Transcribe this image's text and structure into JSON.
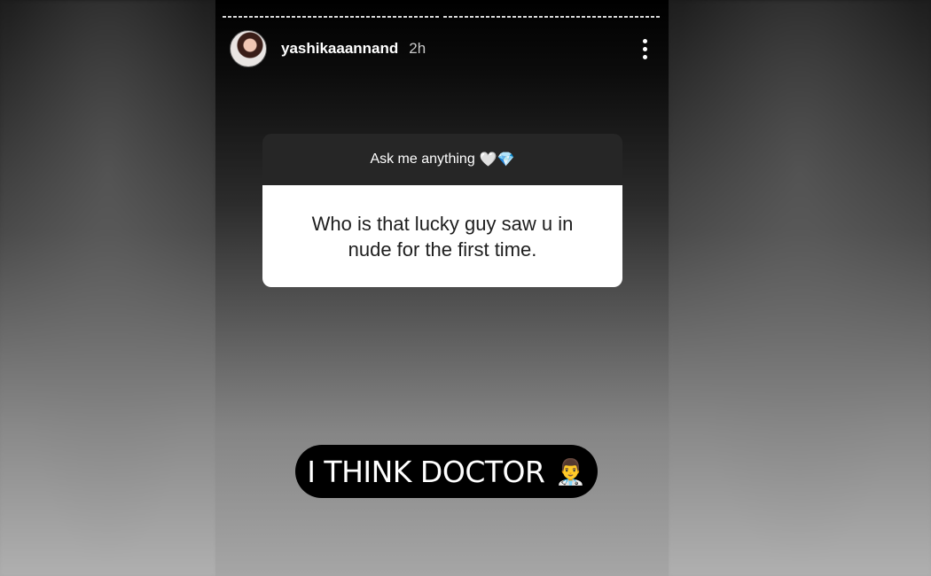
{
  "story": {
    "username": "yashikaaannand",
    "timestamp": "2h",
    "menu_icon": "more-vertical-icon",
    "question": {
      "prompt": "Ask me anything",
      "prompt_emoji": "🤍💎",
      "text": "Who is that lucky guy saw u in nude for the first time."
    },
    "answer": {
      "text": "I THINK DOCTOR",
      "emoji": "👨‍⚕️"
    }
  }
}
